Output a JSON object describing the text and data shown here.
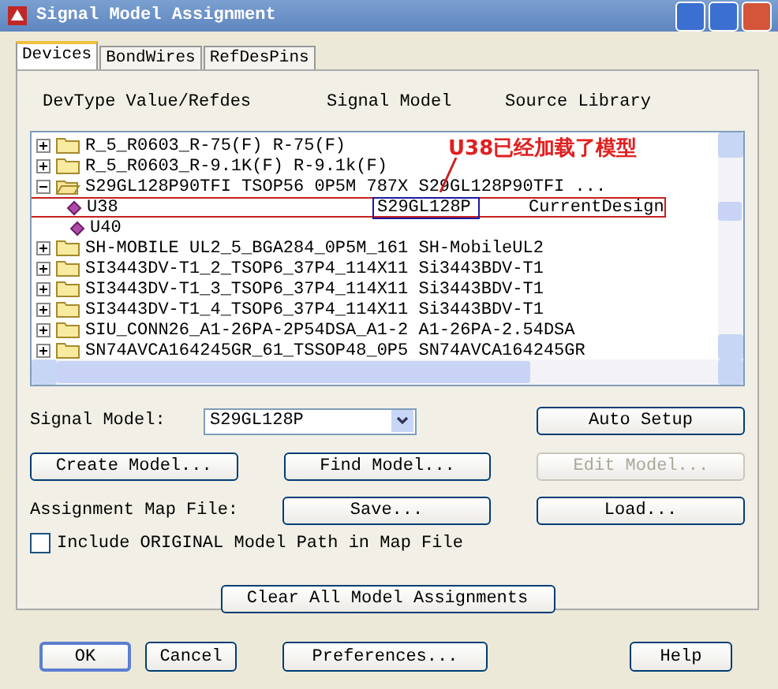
{
  "window": {
    "title": "Signal Model Assignment"
  },
  "tabs": [
    {
      "label": "Devices",
      "selected": true
    },
    {
      "label": "BondWires",
      "selected": false
    },
    {
      "label": "RefDesPins",
      "selected": false
    }
  ],
  "columns": [
    "DevType Value/Refdes",
    "Signal Model",
    "Source Library"
  ],
  "tree": [
    {
      "label": "R_5_R0603_R-75(F) R-75(F)",
      "expanded": false
    },
    {
      "label": "R_5_R0603_R-9.1K(F) R-9.1k(F)",
      "expanded": false
    },
    {
      "label": "S29GL128P90TFI TSOP56 0P5M 787X S29GL128P90TFI ...",
      "expanded": true,
      "children": [
        {
          "label": "U38",
          "model": "S29GL128P",
          "library": "CurrentDesign",
          "annotated": true
        },
        {
          "label": "U40",
          "annotated": false
        }
      ]
    },
    {
      "label": "SH-MOBILE UL2_5_BGA284_0P5M_161 SH-MobileUL2",
      "expanded": false
    },
    {
      "label": "SI3443DV-T1_2_TSOP6_37P4_114X11 Si3443BDV-T1",
      "expanded": false
    },
    {
      "label": "SI3443DV-T1_3_TSOP6_37P4_114X11 Si3443BDV-T1",
      "expanded": false
    },
    {
      "label": "SI3443DV-T1_4_TSOP6_37P4_114X11 Si3443BDV-T1",
      "expanded": false
    },
    {
      "label": "SIU_CONN26_A1-26PA-2P54DSA_A1-2 A1-26PA-2.54DSA",
      "expanded": false
    },
    {
      "label": "SN74AVCA164245GR_61_TSSOP48_0P5 SN74AVCA164245GR",
      "expanded": false
    }
  ],
  "annotation": {
    "text": "U38已经加载了模型"
  },
  "signal_model": {
    "label": "Signal Model:",
    "value": "S29GL128P"
  },
  "buttons_row1": [
    {
      "label": "Auto Setup",
      "disabled": false
    }
  ],
  "buttons_row2": [
    {
      "label": "Create Model...",
      "disabled": false
    },
    {
      "label": "Find Model...",
      "disabled": false
    },
    {
      "label": "Edit Model...",
      "disabled": true
    }
  ],
  "map_file": {
    "label": "Assignment Map File:",
    "buttons": [
      {
        "label": "Save...",
        "disabled": false
      },
      {
        "label": "Load...",
        "disabled": false
      }
    ]
  },
  "include_checkbox": {
    "label": "Include ORIGINAL Model Path in Map File",
    "checked": false
  },
  "clear_button": {
    "label": "Clear All Model Assignments"
  },
  "footer_buttons": [
    {
      "label": "OK",
      "default": true
    },
    {
      "label": "Cancel",
      "default": false
    },
    {
      "label": "Preferences...",
      "default": false
    },
    {
      "label": "Help",
      "default": false
    }
  ]
}
